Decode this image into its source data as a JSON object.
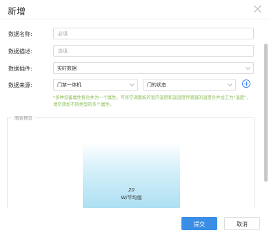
{
  "dialog": {
    "title": "新增"
  },
  "form": {
    "name": {
      "label": "数据名称:",
      "placeholder": "必填"
    },
    "desc": {
      "label": "数据描述:",
      "placeholder": "选填"
    },
    "plugin": {
      "label": "数据插件:",
      "value": "实时数据"
    },
    "source": {
      "label": "数据来源:",
      "device": "门禁一体机",
      "attribute": "门的状态"
    },
    "hint": "*多种设备属性将合并为一个属性，可将空调面板的室内温度和温湿度传感器的温度合并加工为“温度”，请勿添加不同类型的多个属性。"
  },
  "preview": {
    "legend": "图表预览",
    "chart_data": {
      "type": "bar",
      "categories": [
        ""
      ],
      "values": [
        20
      ],
      "value_label": "20",
      "unit_label": "W/平均值"
    }
  },
  "footer": {
    "submit": "提交",
    "cancel": "取消"
  },
  "colors": {
    "primary": "#3a8ee6",
    "hint": "#8bbf5a",
    "bar_top": "#d8f1fa",
    "bar_bottom": "#a8def2"
  }
}
